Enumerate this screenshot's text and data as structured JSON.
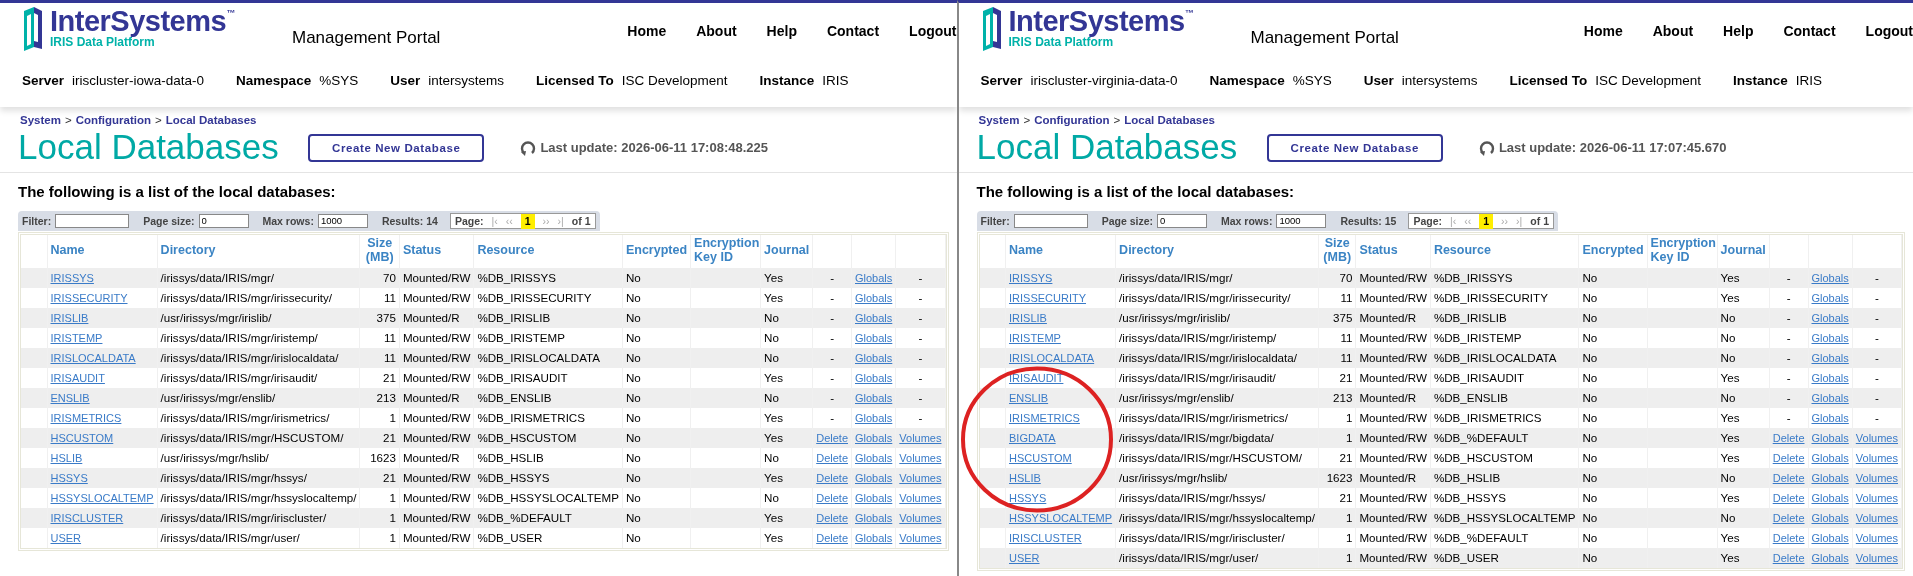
{
  "panes": [
    {
      "header": {
        "logo": {
          "name": "InterSystems",
          "mark": "™",
          "subtitle": "IRIS Data Platform"
        },
        "portal_title": "Management Portal",
        "nav": [
          "Home",
          "About",
          "Help",
          "Contact",
          "Logout"
        ],
        "info": [
          {
            "label": "Server",
            "value": "iriscluster-iowa-data-0"
          },
          {
            "label": "Namespace",
            "value": "%SYS"
          },
          {
            "label": "User",
            "value": "intersystems"
          },
          {
            "label": "Licensed To",
            "value": "ISC Development"
          },
          {
            "label": "Instance",
            "value": "IRIS"
          }
        ]
      },
      "breadcrumb": [
        "System",
        "Configuration",
        "Local Databases"
      ],
      "breadcrumb_separator": ">",
      "title": "Local Databases",
      "create_button": "Create New Database",
      "last_update": "Last update: 2026-06-11 17:08:48.225",
      "list_title": "The following is a list of the local databases:",
      "toolbar": {
        "filter_label": "Filter:",
        "page_size_label": "Page size:",
        "page_size_value": "0",
        "max_rows_label": "Max rows:",
        "max_rows_value": "1000",
        "results": "Results: 14",
        "page_label": "Page:",
        "pager": [
          {
            "label": "|‹",
            "selected": false
          },
          {
            "label": "‹‹",
            "selected": false
          },
          {
            "label": "1",
            "selected": true
          },
          {
            "label": "››",
            "selected": false
          },
          {
            "label": "›|",
            "selected": false
          }
        ],
        "of": "of 1"
      },
      "table": {
        "columns": [
          "Name",
          "Directory",
          "Size (MB)",
          "Status",
          "Resource",
          "Encrypted",
          "Encryption Key ID",
          "Journal"
        ],
        "rows": [
          {
            "name": "IRISSYS",
            "directory": "/irissys/data/IRIS/mgr/",
            "size": "70",
            "status": "Mounted/RW",
            "resource": "%DB_IRISSYS",
            "encrypted": "No",
            "journal": "Yes",
            "actions": [
              {
                "kind": "text",
                "label": "-"
              },
              {
                "kind": "link",
                "label": "Globals"
              },
              {
                "kind": "text",
                "label": "-"
              }
            ]
          },
          {
            "name": "IRISSECURITY",
            "directory": "/irissys/data/IRIS/mgr/irissecurity/",
            "size": "11",
            "status": "Mounted/RW",
            "resource": "%DB_IRISSECURITY",
            "encrypted": "No",
            "journal": "Yes",
            "actions": [
              {
                "kind": "text",
                "label": "-"
              },
              {
                "kind": "link",
                "label": "Globals"
              },
              {
                "kind": "text",
                "label": "-"
              }
            ]
          },
          {
            "name": "IRISLIB",
            "directory": "/usr/irissys/mgr/irislib/",
            "size": "375",
            "status": "Mounted/R",
            "resource": "%DB_IRISLIB",
            "encrypted": "No",
            "journal": "No",
            "actions": [
              {
                "kind": "text",
                "label": "-"
              },
              {
                "kind": "link",
                "label": "Globals"
              },
              {
                "kind": "text",
                "label": "-"
              }
            ]
          },
          {
            "name": "IRISTEMP",
            "directory": "/irissys/data/IRIS/mgr/iristemp/",
            "size": "11",
            "status": "Mounted/RW",
            "resource": "%DB_IRISTEMP",
            "encrypted": "No",
            "journal": "No",
            "actions": [
              {
                "kind": "text",
                "label": "-"
              },
              {
                "kind": "link",
                "label": "Globals"
              },
              {
                "kind": "text",
                "label": "-"
              }
            ]
          },
          {
            "name": "IRISLOCALDATA",
            "directory": "/irissys/data/IRIS/mgr/irislocaldata/",
            "size": "11",
            "status": "Mounted/RW",
            "resource": "%DB_IRISLOCALDATA",
            "encrypted": "No",
            "journal": "No",
            "actions": [
              {
                "kind": "text",
                "label": "-"
              },
              {
                "kind": "link",
                "label": "Globals"
              },
              {
                "kind": "text",
                "label": "-"
              }
            ]
          },
          {
            "name": "IRISAUDIT",
            "directory": "/irissys/data/IRIS/mgr/irisaudit/",
            "size": "21",
            "status": "Mounted/RW",
            "resource": "%DB_IRISAUDIT",
            "encrypted": "No",
            "journal": "Yes",
            "actions": [
              {
                "kind": "text",
                "label": "-"
              },
              {
                "kind": "link",
                "label": "Globals"
              },
              {
                "kind": "text",
                "label": "-"
              }
            ]
          },
          {
            "name": "ENSLIB",
            "directory": "/usr/irissys/mgr/enslib/",
            "size": "213",
            "status": "Mounted/R",
            "resource": "%DB_ENSLIB",
            "encrypted": "No",
            "journal": "No",
            "actions": [
              {
                "kind": "text",
                "label": "-"
              },
              {
                "kind": "link",
                "label": "Globals"
              },
              {
                "kind": "text",
                "label": "-"
              }
            ]
          },
          {
            "name": "IRISMETRICS",
            "directory": "/irissys/data/IRIS/mgr/irismetrics/",
            "size": "1",
            "status": "Mounted/RW",
            "resource": "%DB_IRISMETRICS",
            "encrypted": "No",
            "journal": "Yes",
            "actions": [
              {
                "kind": "text",
                "label": "-"
              },
              {
                "kind": "link",
                "label": "Globals"
              },
              {
                "kind": "text",
                "label": "-"
              }
            ]
          },
          {
            "name": "HSCUSTOM",
            "directory": "/irissys/data/IRIS/mgr/HSCUSTOM/",
            "size": "21",
            "status": "Mounted/RW",
            "resource": "%DB_HSCUSTOM",
            "encrypted": "No",
            "journal": "Yes",
            "actions": [
              {
                "kind": "link",
                "label": "Delete"
              },
              {
                "kind": "link",
                "label": "Globals"
              },
              {
                "kind": "link",
                "label": "Volumes"
              }
            ]
          },
          {
            "name": "HSLIB",
            "directory": "/usr/irissys/mgr/hslib/",
            "size": "1623",
            "status": "Mounted/R",
            "resource": "%DB_HSLIB",
            "encrypted": "No",
            "journal": "No",
            "actions": [
              {
                "kind": "link",
                "label": "Delete"
              },
              {
                "kind": "link",
                "label": "Globals"
              },
              {
                "kind": "link",
                "label": "Volumes"
              }
            ]
          },
          {
            "name": "HSSYS",
            "directory": "/irissys/data/IRIS/mgr/hssys/",
            "size": "21",
            "status": "Mounted/RW",
            "resource": "%DB_HSSYS",
            "encrypted": "No",
            "journal": "Yes",
            "actions": [
              {
                "kind": "link",
                "label": "Delete"
              },
              {
                "kind": "link",
                "label": "Globals"
              },
              {
                "kind": "link",
                "label": "Volumes"
              }
            ]
          },
          {
            "name": "HSSYSLOCALTEMP",
            "directory": "/irissys/data/IRIS/mgr/hssyslocaltemp/",
            "size": "1",
            "status": "Mounted/RW",
            "resource": "%DB_HSSYSLOCALTEMP",
            "encrypted": "No",
            "journal": "No",
            "actions": [
              {
                "kind": "link",
                "label": "Delete"
              },
              {
                "kind": "link",
                "label": "Globals"
              },
              {
                "kind": "link",
                "label": "Volumes"
              }
            ]
          },
          {
            "name": "IRISCLUSTER",
            "directory": "/irissys/data/IRIS/mgr/iriscluster/",
            "size": "1",
            "status": "Mounted/RW",
            "resource": "%DB_%DEFAULT",
            "encrypted": "No",
            "journal": "Yes",
            "actions": [
              {
                "kind": "link",
                "label": "Delete"
              },
              {
                "kind": "link",
                "label": "Globals"
              },
              {
                "kind": "link",
                "label": "Volumes"
              }
            ]
          },
          {
            "name": "USER",
            "directory": "/irissys/data/IRIS/mgr/user/",
            "size": "1",
            "status": "Mounted/RW",
            "resource": "%DB_USER",
            "encrypted": "No",
            "journal": "Yes",
            "actions": [
              {
                "kind": "link",
                "label": "Delete"
              },
              {
                "kind": "link",
                "label": "Globals"
              },
              {
                "kind": "link",
                "label": "Volumes"
              }
            ]
          }
        ]
      }
    },
    {
      "header": {
        "logo": {
          "name": "InterSystems",
          "mark": "™",
          "subtitle": "IRIS Data Platform"
        },
        "portal_title": "Management Portal",
        "nav": [
          "Home",
          "About",
          "Help",
          "Contact",
          "Logout"
        ],
        "info": [
          {
            "label": "Server",
            "value": "iriscluster-virginia-data-0"
          },
          {
            "label": "Namespace",
            "value": "%SYS"
          },
          {
            "label": "User",
            "value": "intersystems"
          },
          {
            "label": "Licensed To",
            "value": "ISC Development"
          },
          {
            "label": "Instance",
            "value": "IRIS"
          }
        ]
      },
      "breadcrumb": [
        "System",
        "Configuration",
        "Local Databases"
      ],
      "breadcrumb_separator": ">",
      "title": "Local Databases",
      "create_button": "Create New Database",
      "last_update": "Last update: 2026-06-11 17:07:45.670",
      "list_title": "The following is a list of the local databases:",
      "toolbar": {
        "filter_label": "Filter:",
        "page_size_label": "Page size:",
        "page_size_value": "0",
        "max_rows_label": "Max rows:",
        "max_rows_value": "1000",
        "results": "Results: 15",
        "page_label": "Page:",
        "pager": [
          {
            "label": "|‹",
            "selected": false
          },
          {
            "label": "‹‹",
            "selected": false
          },
          {
            "label": "1",
            "selected": true
          },
          {
            "label": "››",
            "selected": false
          },
          {
            "label": "›|",
            "selected": false
          }
        ],
        "of": "of 1"
      },
      "table": {
        "columns": [
          "Name",
          "Directory",
          "Size (MB)",
          "Status",
          "Resource",
          "Encrypted",
          "Encryption Key ID",
          "Journal"
        ],
        "rows": [
          {
            "name": "IRISSYS",
            "directory": "/irissys/data/IRIS/mgr/",
            "size": "70",
            "status": "Mounted/RW",
            "resource": "%DB_IRISSYS",
            "encrypted": "No",
            "journal": "Yes",
            "actions": [
              {
                "kind": "text",
                "label": "-"
              },
              {
                "kind": "link",
                "label": "Globals"
              },
              {
                "kind": "text",
                "label": "-"
              }
            ]
          },
          {
            "name": "IRISSECURITY",
            "directory": "/irissys/data/IRIS/mgr/irissecurity/",
            "size": "11",
            "status": "Mounted/RW",
            "resource": "%DB_IRISSECURITY",
            "encrypted": "No",
            "journal": "Yes",
            "actions": [
              {
                "kind": "text",
                "label": "-"
              },
              {
                "kind": "link",
                "label": "Globals"
              },
              {
                "kind": "text",
                "label": "-"
              }
            ]
          },
          {
            "name": "IRISLIB",
            "directory": "/usr/irissys/mgr/irislib/",
            "size": "375",
            "status": "Mounted/R",
            "resource": "%DB_IRISLIB",
            "encrypted": "No",
            "journal": "No",
            "actions": [
              {
                "kind": "text",
                "label": "-"
              },
              {
                "kind": "link",
                "label": "Globals"
              },
              {
                "kind": "text",
                "label": "-"
              }
            ]
          },
          {
            "name": "IRISTEMP",
            "directory": "/irissys/data/IRIS/mgr/iristemp/",
            "size": "11",
            "status": "Mounted/RW",
            "resource": "%DB_IRISTEMP",
            "encrypted": "No",
            "journal": "No",
            "actions": [
              {
                "kind": "text",
                "label": "-"
              },
              {
                "kind": "link",
                "label": "Globals"
              },
              {
                "kind": "text",
                "label": "-"
              }
            ]
          },
          {
            "name": "IRISLOCALDATA",
            "directory": "/irissys/data/IRIS/mgr/irislocaldata/",
            "size": "11",
            "status": "Mounted/RW",
            "resource": "%DB_IRISLOCALDATA",
            "encrypted": "No",
            "journal": "No",
            "actions": [
              {
                "kind": "text",
                "label": "-"
              },
              {
                "kind": "link",
                "label": "Globals"
              },
              {
                "kind": "text",
                "label": "-"
              }
            ]
          },
          {
            "name": "IRISAUDIT",
            "directory": "/irissys/data/IRIS/mgr/irisaudit/",
            "size": "21",
            "status": "Mounted/RW",
            "resource": "%DB_IRISAUDIT",
            "encrypted": "No",
            "journal": "Yes",
            "actions": [
              {
                "kind": "text",
                "label": "-"
              },
              {
                "kind": "link",
                "label": "Globals"
              },
              {
                "kind": "text",
                "label": "-"
              }
            ]
          },
          {
            "name": "ENSLIB",
            "directory": "/usr/irissys/mgr/enslib/",
            "size": "213",
            "status": "Mounted/R",
            "resource": "%DB_ENSLIB",
            "encrypted": "No",
            "journal": "No",
            "actions": [
              {
                "kind": "text",
                "label": "-"
              },
              {
                "kind": "link",
                "label": "Globals"
              },
              {
                "kind": "text",
                "label": "-"
              }
            ]
          },
          {
            "name": "IRISMETRICS",
            "directory": "/irissys/data/IRIS/mgr/irismetrics/",
            "size": "1",
            "status": "Mounted/RW",
            "resource": "%DB_IRISMETRICS",
            "encrypted": "No",
            "journal": "Yes",
            "actions": [
              {
                "kind": "text",
                "label": "-"
              },
              {
                "kind": "link",
                "label": "Globals"
              },
              {
                "kind": "text",
                "label": "-"
              }
            ]
          },
          {
            "name": "BIGDATA",
            "directory": "/irissys/data/IRIS/mgr/bigdata/",
            "size": "1",
            "status": "Mounted/RW",
            "resource": "%DB_%DEFAULT",
            "encrypted": "No",
            "journal": "Yes",
            "actions": [
              {
                "kind": "link",
                "label": "Delete"
              },
              {
                "kind": "link",
                "label": "Globals"
              },
              {
                "kind": "link",
                "label": "Volumes"
              }
            ]
          },
          {
            "name": "HSCUSTOM",
            "directory": "/irissys/data/IRIS/mgr/HSCUSTOM/",
            "size": "21",
            "status": "Mounted/RW",
            "resource": "%DB_HSCUSTOM",
            "encrypted": "No",
            "journal": "Yes",
            "actions": [
              {
                "kind": "link",
                "label": "Delete"
              },
              {
                "kind": "link",
                "label": "Globals"
              },
              {
                "kind": "link",
                "label": "Volumes"
              }
            ]
          },
          {
            "name": "HSLIB",
            "directory": "/usr/irissys/mgr/hslib/",
            "size": "1623",
            "status": "Mounted/R",
            "resource": "%DB_HSLIB",
            "encrypted": "No",
            "journal": "No",
            "actions": [
              {
                "kind": "link",
                "label": "Delete"
              },
              {
                "kind": "link",
                "label": "Globals"
              },
              {
                "kind": "link",
                "label": "Volumes"
              }
            ]
          },
          {
            "name": "HSSYS",
            "directory": "/irissys/data/IRIS/mgr/hssys/",
            "size": "21",
            "status": "Mounted/RW",
            "resource": "%DB_HSSYS",
            "encrypted": "No",
            "journal": "Yes",
            "actions": [
              {
                "kind": "link",
                "label": "Delete"
              },
              {
                "kind": "link",
                "label": "Globals"
              },
              {
                "kind": "link",
                "label": "Volumes"
              }
            ]
          },
          {
            "name": "HSSYSLOCALTEMP",
            "directory": "/irissys/data/IRIS/mgr/hssyslocaltemp/",
            "size": "1",
            "status": "Mounted/RW",
            "resource": "%DB_HSSYSLOCALTEMP",
            "encrypted": "No",
            "journal": "No",
            "actions": [
              {
                "kind": "link",
                "label": "Delete"
              },
              {
                "kind": "link",
                "label": "Globals"
              },
              {
                "kind": "link",
                "label": "Volumes"
              }
            ]
          },
          {
            "name": "IRISCLUSTER",
            "directory": "/irissys/data/IRIS/mgr/iriscluster/",
            "size": "1",
            "status": "Mounted/RW",
            "resource": "%DB_%DEFAULT",
            "encrypted": "No",
            "journal": "Yes",
            "actions": [
              {
                "kind": "link",
                "label": "Delete"
              },
              {
                "kind": "link",
                "label": "Globals"
              },
              {
                "kind": "link",
                "label": "Volumes"
              }
            ]
          },
          {
            "name": "USER",
            "directory": "/irissys/data/IRIS/mgr/user/",
            "size": "1",
            "status": "Mounted/RW",
            "resource": "%DB_USER",
            "encrypted": "No",
            "journal": "Yes",
            "actions": [
              {
                "kind": "link",
                "label": "Delete"
              },
              {
                "kind": "link",
                "label": "Globals"
              },
              {
                "kind": "link",
                "label": "Volumes"
              }
            ]
          }
        ]
      },
      "annotation": {
        "kind": "circle"
      }
    }
  ]
}
